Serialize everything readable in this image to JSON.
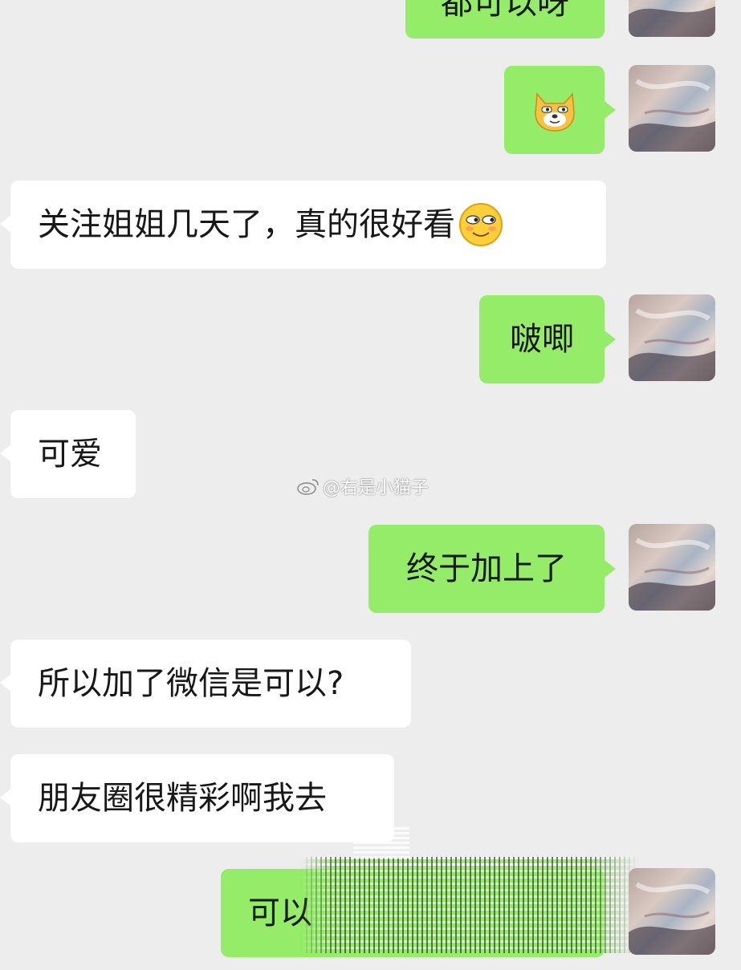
{
  "messages": [
    {
      "side": "self",
      "text": "都可以呀"
    },
    {
      "side": "self",
      "emoji": "doge-emoji",
      "text": ""
    },
    {
      "side": "other",
      "text": "关注姐姐几天了，真的很好看",
      "trailing_emoji": "smirk-emoji"
    },
    {
      "side": "self",
      "text": "啵唧"
    },
    {
      "side": "other",
      "text": "可爱"
    },
    {
      "side": "self",
      "text": "终于加上了"
    },
    {
      "side": "other",
      "text": "所以加了微信是可以?"
    },
    {
      "side": "other",
      "text": "朋友圈很精彩啊我去"
    },
    {
      "side": "self",
      "text": "可以"
    }
  ],
  "watermark": {
    "icon": "weibo-icon",
    "text": "@右是小猫子"
  },
  "colors": {
    "background": "#ededed",
    "self_bubble": "#95ec69",
    "other_bubble": "#ffffff",
    "text": "#181818"
  }
}
